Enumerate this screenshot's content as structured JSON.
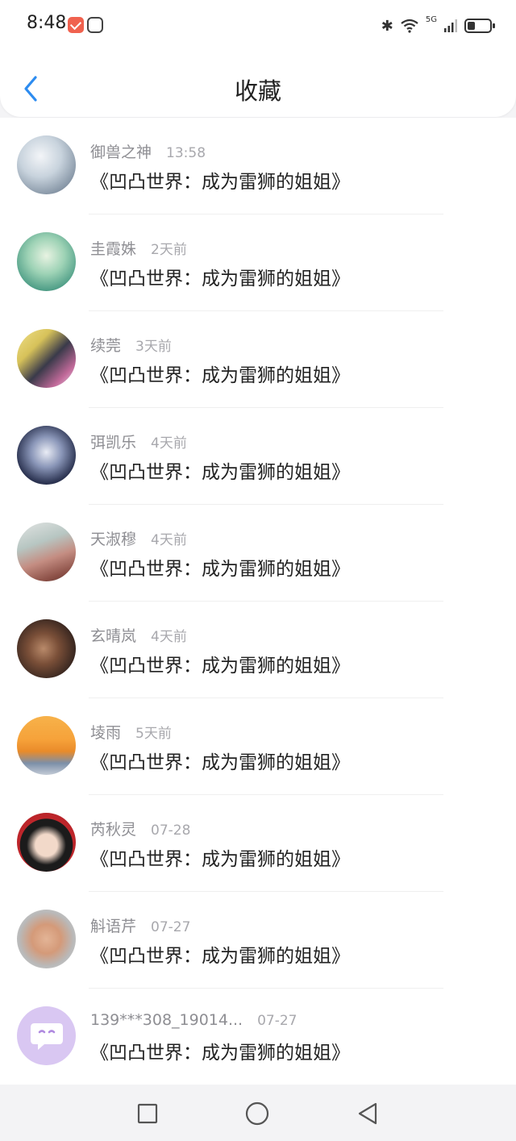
{
  "status_bar": {
    "time": "8:48",
    "network": "5G"
  },
  "header": {
    "title": "收藏"
  },
  "items": [
    {
      "name": "御兽之神",
      "time": "13:58",
      "content": "《凹凸世界：成为雷狮的姐姐》"
    },
    {
      "name": "圭霞姝",
      "time": "2天前",
      "content": "《凹凸世界：成为雷狮的姐姐》"
    },
    {
      "name": "续莞",
      "time": "3天前",
      "content": "《凹凸世界：成为雷狮的姐姐》"
    },
    {
      "name": "弭凯乐",
      "time": "4天前",
      "content": "《凹凸世界：成为雷狮的姐姐》"
    },
    {
      "name": "天淑穆",
      "time": "4天前",
      "content": "《凹凸世界：成为雷狮的姐姐》"
    },
    {
      "name": "玄晴岚",
      "time": "4天前",
      "content": "《凹凸世界：成为雷狮的姐姐》"
    },
    {
      "name": "堎雨",
      "time": "5天前",
      "content": "《凹凸世界：成为雷狮的姐姐》"
    },
    {
      "name": "芮秋灵",
      "time": "07-28",
      "content": "《凹凸世界：成为雷狮的姐姐》"
    },
    {
      "name": "斛语芹",
      "time": "07-27",
      "content": "《凹凸世界：成为雷狮的姐姐》"
    },
    {
      "name": "139***308_19014...",
      "time": "07-27",
      "content": "《凹凸世界：成为雷狮的姐姐》"
    }
  ],
  "colors": {
    "accent": "#2d8cf0",
    "default_avatar": "#d9c7f2"
  },
  "icons": [
    "back-arrow-icon",
    "bluetooth-icon",
    "wifi-icon",
    "signal-icon",
    "battery-icon",
    "recent-apps-icon",
    "home-icon",
    "back-icon"
  ],
  "battery_level": 0.35
}
